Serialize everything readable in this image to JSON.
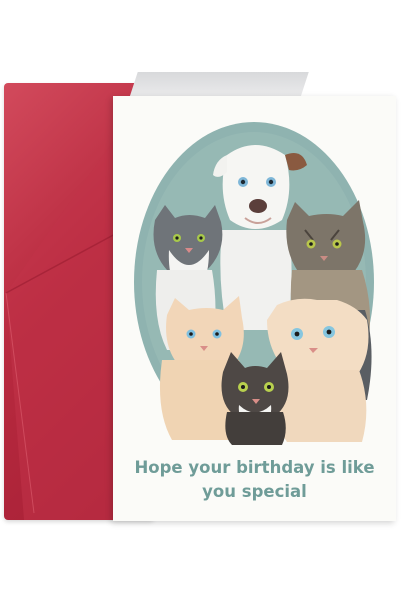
{
  "card": {
    "greeting": "Hope your birthday is like you special"
  },
  "palette": {
    "envelope": "#b82a3f",
    "oval_background": "#8fb3b0",
    "greeting_text": "#6f9c98",
    "card": "#fbfbf8"
  },
  "illustration": {
    "animals": [
      "white-dog",
      "grey-white-cat",
      "tabby-cat",
      "tabby-longhair-cat",
      "cream-cat-blue-eyes",
      "cream-cat-blue-eyes-right",
      "small-tabby-cat"
    ]
  }
}
